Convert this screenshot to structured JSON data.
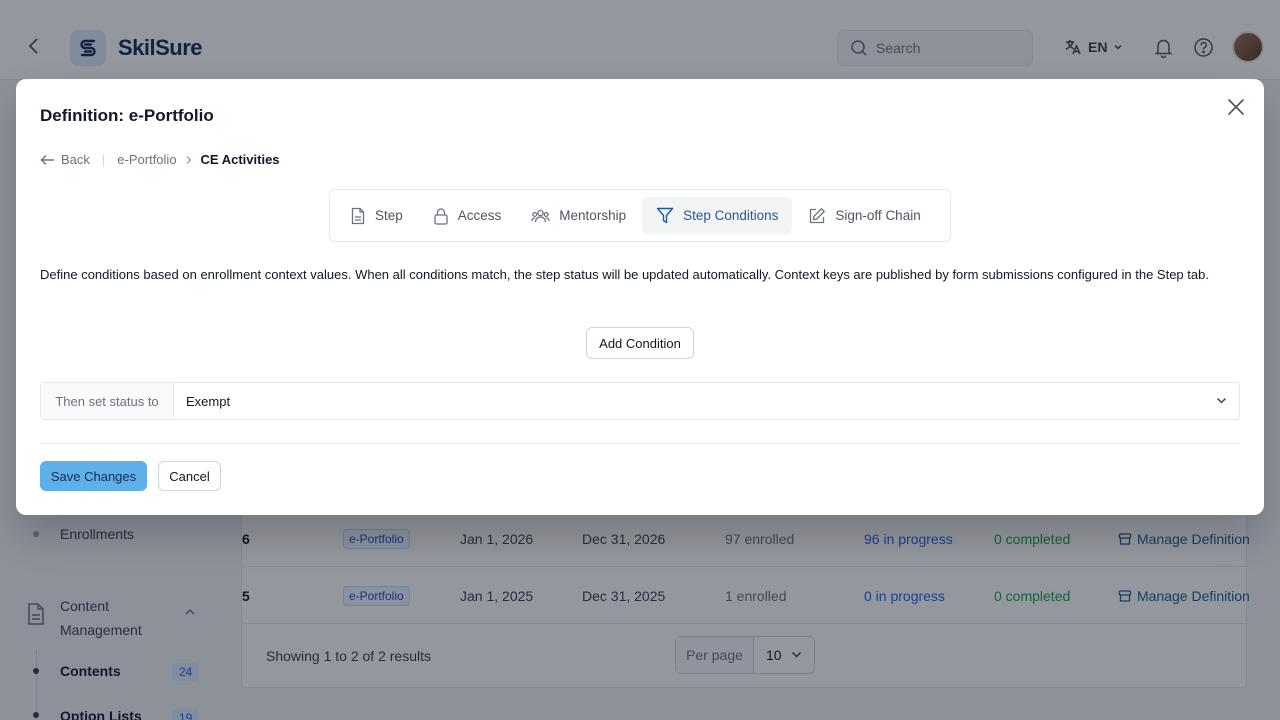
{
  "app": {
    "name": "SkilSure",
    "search_placeholder": "Search",
    "language": "EN",
    "icons": [
      "back-arrow-icon",
      "logo-icon",
      "search-icon",
      "translate-icon",
      "bell-icon",
      "help-icon"
    ]
  },
  "sidebar": {
    "enrollments_label": "Enrollments",
    "section_title": "Content Management",
    "items": [
      {
        "label": "Contents",
        "count": "24"
      },
      {
        "label": "Option Lists",
        "count": "19"
      }
    ]
  },
  "table": {
    "rows": [
      {
        "id": "6",
        "tag": "e-Portfolio",
        "start": "Jan 1, 2026",
        "end": "Dec 31, 2026",
        "enrolled": "97 enrolled",
        "in_progress": "96 in progress",
        "completed": "0 completed",
        "action": "Manage Definition"
      },
      {
        "id": "5",
        "tag": "e-Portfolio",
        "start": "Jan 1, 2025",
        "end": "Dec 31, 2025",
        "enrolled": "1 enrolled",
        "in_progress": "0 in progress",
        "completed": "0 completed",
        "action": "Manage Definition"
      }
    ],
    "showing_text": "Showing 1 to 2 of 2 results",
    "per_page_label": "Per page",
    "per_page_value": "10"
  },
  "modal": {
    "title": "Definition: e-Portfolio",
    "breadcrumb": {
      "back": "Back",
      "parent": "e-Portfolio",
      "current": "CE Activities"
    },
    "tabs": [
      {
        "label": "Step",
        "icon": "document-icon"
      },
      {
        "label": "Access",
        "icon": "lock-icon"
      },
      {
        "label": "Mentorship",
        "icon": "users-icon"
      },
      {
        "label": "Step Conditions",
        "icon": "filter-icon",
        "active": true
      },
      {
        "label": "Sign-off Chain",
        "icon": "edit-icon"
      }
    ],
    "description": "Define conditions based on enrollment context values. When all conditions match, the step status will be updated automatically. Context keys are published by form submissions configured in the Step tab.",
    "add_condition_label": "Add Condition",
    "status_label": "Then set status to",
    "status_value": "Exempt",
    "save_label": "Save Changes",
    "cancel_label": "Cancel"
  },
  "colors": {
    "accent": "#1e5a94",
    "save_button": "#5fb0ea",
    "overlay": "#111827"
  }
}
